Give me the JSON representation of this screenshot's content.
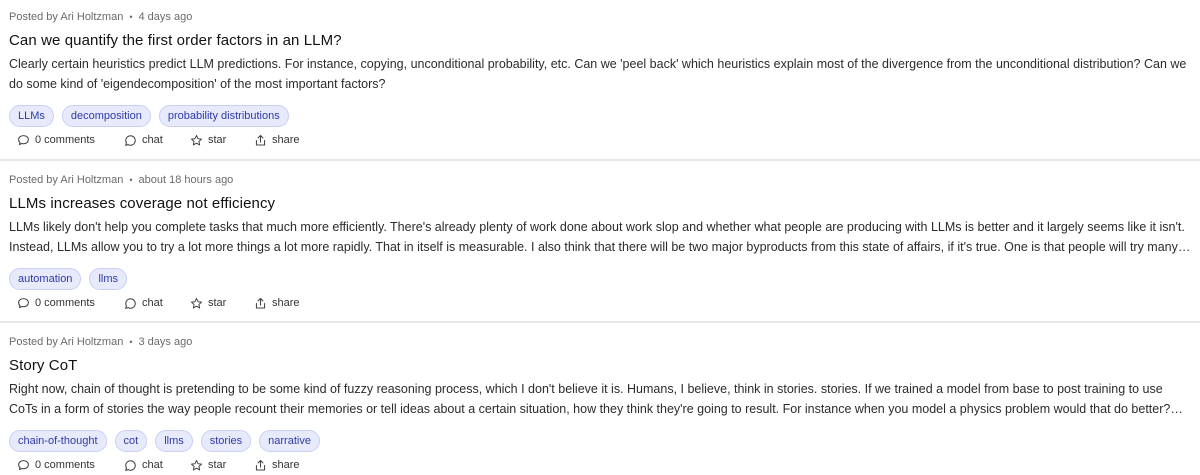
{
  "posts": [
    {
      "author_prefix": "Posted by Ari Holtzman",
      "separator": "•",
      "time": "4 days ago",
      "title": "Can we quantify the first order factors in an LLM?",
      "body": "Clearly certain heuristics predict LLM predictions. For instance, copying, unconditional probability, etc. Can we 'peel back' which heuristics explain most of the divergence from the unconditional distribution? Can we do some kind of 'eigendecomposition' of the most important factors?",
      "tags": [
        "LLMs",
        "decomposition",
        "probability distributions"
      ],
      "comments_label": "0 comments",
      "chat_label": "chat",
      "star_label": "star",
      "share_label": "share"
    },
    {
      "author_prefix": "Posted by Ari Holtzman",
      "separator": "•",
      "time": "about 18 hours ago",
      "title": "LLMs increases coverage not efficiency",
      "body": "LLMs likely don't help you complete tasks that much more efficiently. There's already plenty of work done about work slop and whether what people are producing with LLMs is better and it largely seems like it isn't. Instead, LLMs allow you to try a lot more things a lot more rapidly. That in itself is measurable. I also think that there will be two major byproducts from this state of affairs, if it's true. One is that people will try many…",
      "tags": [
        "automation",
        "llms"
      ],
      "comments_label": "0 comments",
      "chat_label": "chat",
      "star_label": "star",
      "share_label": "share"
    },
    {
      "author_prefix": "Posted by Ari Holtzman",
      "separator": "•",
      "time": "3 days ago",
      "title": "Story CoT",
      "body": "Right now, chain of thought is pretending to be some kind of fuzzy reasoning process, which I don't believe it is. Humans, I believe, think in stories. stories. If we trained a model from base to post training to use CoTs in a form of stories the way people recount their memories or tell ideas about a certain situation, how they think they're going to result. For instance when you model a physics problem would that do better?…",
      "tags": [
        "chain-of-thought",
        "cot",
        "llms",
        "stories",
        "narrative"
      ],
      "comments_label": "0 comments",
      "chat_label": "chat",
      "star_label": "star",
      "share_label": "share"
    }
  ],
  "icons": {
    "comments": "comment-bubble-icon",
    "chat": "chat-bubble-icon",
    "star": "star-icon",
    "share": "share-upload-icon"
  },
  "colors": {
    "tag_bg": "#e7eafb",
    "tag_text": "#2f3aa8",
    "divider": "#e6e6e6",
    "meta_text": "#6b6b6b"
  }
}
